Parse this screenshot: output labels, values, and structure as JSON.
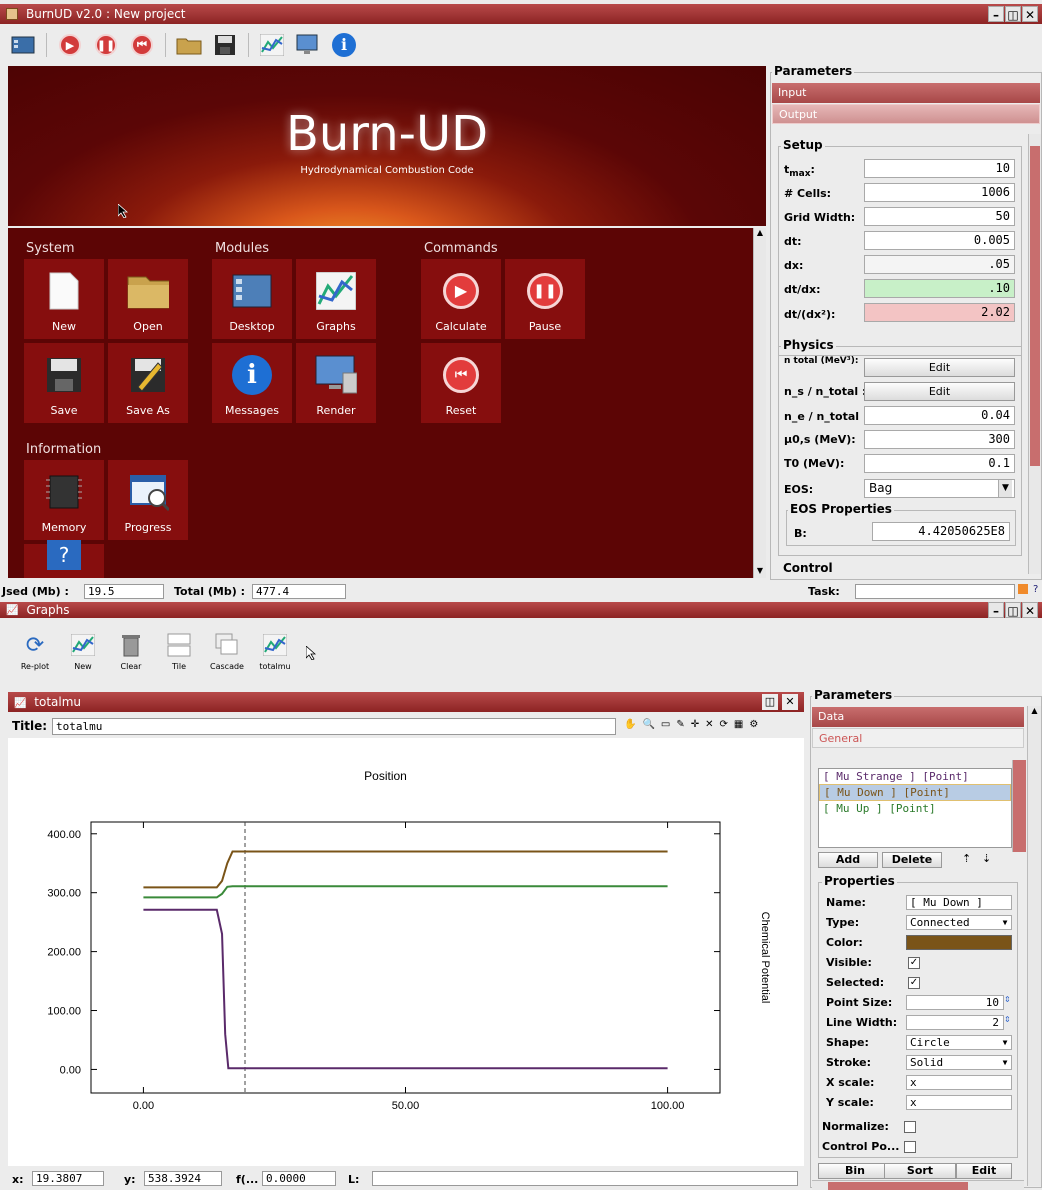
{
  "window": {
    "title": "BurnUD v2.0 : New project"
  },
  "banner": {
    "title": "Burn-UD",
    "subtitle": "Hydrodynamical Combustion Code"
  },
  "sections": {
    "system": "System",
    "modules": "Modules",
    "commands": "Commands",
    "information": "Information"
  },
  "tiles": {
    "new": "New",
    "open": "Open",
    "save": "Save",
    "save_as": "Save As",
    "desktop": "Desktop",
    "graphs": "Graphs",
    "messages": "Messages",
    "render": "Render",
    "calculate": "Calculate",
    "pause": "Pause",
    "reset": "Reset",
    "memory": "Memory",
    "progress": "Progress"
  },
  "params": {
    "title": "Parameters",
    "tab_input": "Input",
    "tab_output": "Output",
    "setup_title": "Setup",
    "tmax_label": "t",
    "tmax_sub": "max",
    "tmax_colon": ":",
    "tmax": "10",
    "cells_label": "# Cells:",
    "cells": "1006",
    "grid_label": "Grid Width:",
    "grid": "50",
    "dt_label": "dt:",
    "dt": "0.005",
    "dx_label": "dx:",
    "dx": ".05",
    "dtdx_label": "dt/dx:",
    "dtdx": ".10",
    "dtdx2_label": "dt/(dx²):",
    "dtdx2": "2.02",
    "physics_title": "Physics",
    "ntotal_label": "n total (MeV³):",
    "ns_label": "n_s / n_total :",
    "ne_label": "n_e / n_total :",
    "ne": "0.04",
    "mu_label": "μ0,s (MeV):",
    "mu": "300",
    "t0_label": "T0 (MeV):",
    "t0": "0.1",
    "eos_label": "EOS:",
    "eos": "Bag",
    "eos_props_title": "EOS Properties",
    "b_label": "B:",
    "b": "4.42050625E8",
    "edit": "Edit",
    "control_title": "Control"
  },
  "status": {
    "used_label": "Jsed (Mb) :",
    "used": "19.5",
    "total_label": "Total (Mb) :",
    "total": "477.4",
    "task_label": "Task:"
  },
  "graphs_window": {
    "title": "Graphs"
  },
  "graph_toolbar": {
    "replot": "Re-plot",
    "new": "New",
    "clear": "Clear",
    "tile": "Tile",
    "cascade": "Cascade",
    "totalmu": "totalmu"
  },
  "plot_window": {
    "title": "totalmu",
    "title_label": "Title:",
    "title_value": "totalmu"
  },
  "chart_data": {
    "type": "line",
    "title": "Position",
    "xlabel": "",
    "ylabel": "Chemical Potential",
    "xlim": [
      -10,
      110
    ],
    "ylim": [
      -40,
      420
    ],
    "x_ticks": [
      "0.00",
      "50.00",
      "100.00"
    ],
    "y_ticks": [
      "0.00",
      "100.00",
      "200.00",
      "300.00",
      "400.00"
    ],
    "marker_x": 19.3807,
    "series": [
      {
        "color": "#7a5418",
        "x": [
          0,
          14,
          15,
          16,
          17,
          100
        ],
        "y": [
          309,
          309,
          320,
          350,
          370,
          370
        ]
      },
      {
        "color": "#3a8a3a",
        "x": [
          0,
          14,
          15,
          16,
          17,
          100
        ],
        "y": [
          292,
          292,
          298,
          310,
          311,
          311
        ]
      },
      {
        "color": "#5a2a6a",
        "x": [
          0,
          14,
          15,
          15.6,
          16.2,
          100
        ],
        "y": [
          271,
          271,
          230,
          60,
          2,
          2
        ]
      }
    ]
  },
  "status_bottom": {
    "x_label": "x:",
    "x": "19.3807",
    "y_label": "y:",
    "y": "538.3924",
    "f_label": "f(...",
    "f": "0.0000",
    "l_label": "L:"
  },
  "graph_params": {
    "title": "Parameters",
    "tab_data": "Data",
    "tab_general": "General",
    "series_list": [
      "[ Mu Strange ] [Point]",
      "[ Mu Down ] [Point]",
      "[ Mu Up ] [Point]"
    ],
    "add": "Add",
    "delete": "Delete",
    "props_title": "Properties",
    "name_label": "Name:",
    "name": "[ Mu Down ]",
    "type_label": "Type:",
    "type": "Connected",
    "color_label": "Color:",
    "color": "#7a5418",
    "visible_label": "Visible:",
    "selected_label": "Selected:",
    "point_size_label": "Point Size:",
    "point_size": "10",
    "line_width_label": "Line Width:",
    "line_width": "2",
    "shape_label": "Shape:",
    "shape": "Circle",
    "stroke_label": "Stroke:",
    "stroke": "Solid",
    "xscale_label": "X scale:",
    "xscale": "x",
    "yscale_label": "Y scale:",
    "yscale": "x",
    "normalize_label": "Normalize:",
    "control_label": "Control Po...",
    "bin": "Bin",
    "sort": "Sort",
    "edit": "Edit"
  }
}
